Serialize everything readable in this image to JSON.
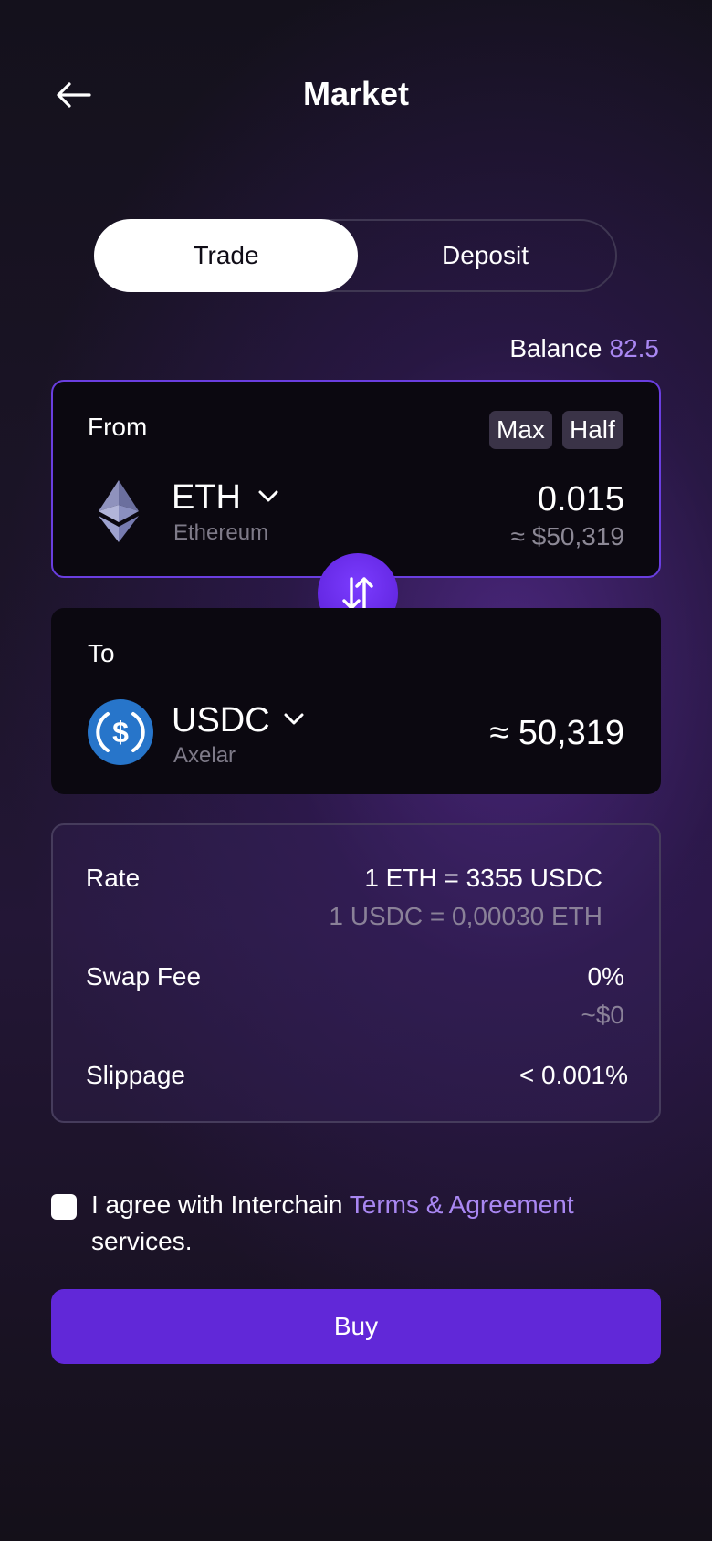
{
  "header": {
    "title": "Market"
  },
  "tabs": [
    {
      "label": "Trade",
      "active": true
    },
    {
      "label": "Deposit",
      "active": false
    }
  ],
  "balance": {
    "label": "Balance",
    "value": "82.5"
  },
  "from": {
    "label": "From",
    "max_label": "Max",
    "half_label": "Half",
    "token_symbol": "ETH",
    "token_name": "Ethereum",
    "amount": "0.015",
    "amount_fiat": "≈ $50,319"
  },
  "to": {
    "label": "To",
    "token_symbol": "USDC",
    "token_name": "Axelar",
    "amount": "≈ 50,319"
  },
  "details": {
    "rate_label": "Rate",
    "rate_primary": "1 ETH = 3355 USDC",
    "rate_secondary": "1 USDC = 0,00030 ETH",
    "fee_label": "Swap Fee",
    "fee_value": "0%",
    "fee_fiat": "~$0",
    "slippage_label": "Slippage",
    "slippage_value": "< 0.001%"
  },
  "agreement": {
    "text_before": "I agree with Interchain ",
    "link_text": "Terms & Agreement",
    "text_after": "services."
  },
  "buy_button": {
    "label": "Buy"
  },
  "colors": {
    "accent": "#6128d8",
    "accent_text": "#a987f2",
    "swap_button": "#6a2ef0",
    "usdc_blue": "#2775ca"
  },
  "icons": {
    "back": "arrow-left-icon",
    "swap": "swap-vertical-icon",
    "eth": "ethereum-logo-icon",
    "usdc": "usdc-logo-icon",
    "dropdown": "chevron-down-icon"
  }
}
